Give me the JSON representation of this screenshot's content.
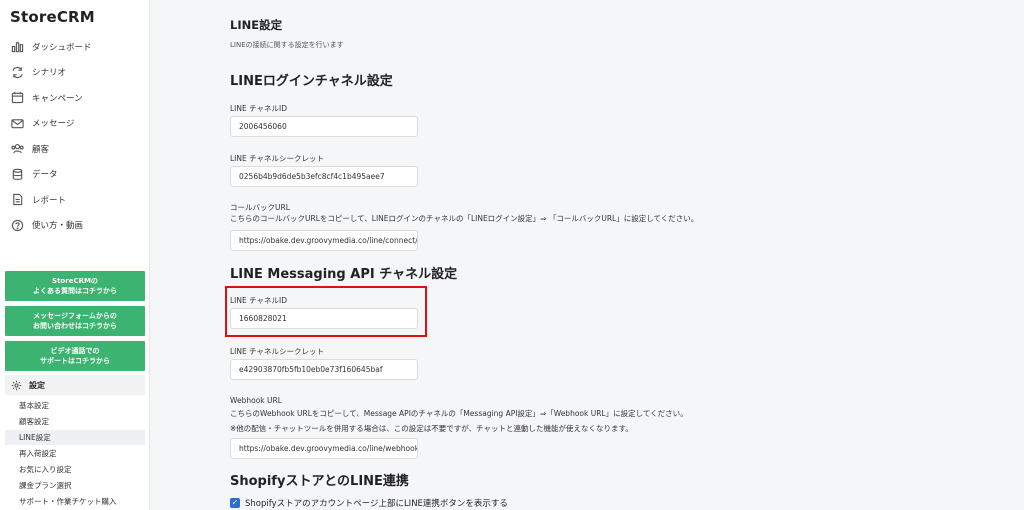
{
  "app": {
    "logo": "StoreCRM"
  },
  "nav": [
    {
      "label": "ダッシュボード",
      "icon": "bar-chart-icon"
    },
    {
      "label": "シナリオ",
      "icon": "refresh-icon"
    },
    {
      "label": "キャンペーン",
      "icon": "calendar-icon"
    },
    {
      "label": "メッセージ",
      "icon": "mail-icon"
    },
    {
      "label": "顧客",
      "icon": "users-icon"
    },
    {
      "label": "データ",
      "icon": "database-icon"
    },
    {
      "label": "レポート",
      "icon": "document-icon"
    },
    {
      "label": "使い方・動画",
      "icon": "question-icon"
    }
  ],
  "help_buttons": [
    {
      "line1": "StoreCRMの",
      "line2": "よくある質問はコチラから"
    },
    {
      "line1": "メッセージフォームからの",
      "line2": "お問い合わせはコチラから"
    },
    {
      "line1": "ビデオ通話での",
      "line2": "サポートはコチラから"
    }
  ],
  "settings": {
    "label": "設定",
    "items": [
      "基本設定",
      "顧客設定",
      "LINE設定",
      "再入荷設定",
      "お気に入り設定",
      "課金プラン選択",
      "サポート・作業チケット購入"
    ],
    "active_index": 2
  },
  "page": {
    "title": "LINE設定",
    "description": "LINEの接続に関する設定を行います",
    "login_section": {
      "heading": "LINEログインチャネル設定",
      "channel_id_label": "LINE チャネルID",
      "channel_id": "2006456060",
      "secret_label": "LINE チャネルシークレット",
      "secret": "0256b4b9d6de5b3efc8cf4c1b495aee7",
      "callback_label": "コールバックURL",
      "callback_note": "こちらのコールバックURLをコピーして、LINEログインのチャネルの「LINEログイン設定」⇒ 「コールバックURL」に設定してください。",
      "callback_url": "https://obake.dev.groovymedia.co/line/connect/"
    },
    "messaging_section": {
      "heading": "LINE Messaging API チャネル設定",
      "channel_id_label": "LINE チャネルID",
      "channel_id": "1660828021",
      "secret_label": "LINE チャネルシークレット",
      "secret": "e42903870fb5fb10eb0e73f160645baf",
      "webhook_label": "Webhook URL",
      "webhook_note1": "こちらのWebhook URLをコピーして、Message APIのチャネルの「Messaging API設定」⇒「Webhook URL」に設定してください。",
      "webhook_note2": "※他の配信・チャットツールを併用する場合は、この設定は不要ですが、チャットと連動した機能が使えなくなります。",
      "webhook_url": "https://obake.dev.groovymedia.co/line/webhook"
    },
    "shopify_section": {
      "heading": "ShopifyストアとのLINE連携",
      "checkbox_label": "Shopifyストアのアカウントページ上部にLINE連携ボタンを表示する",
      "checked": true
    }
  },
  "colors": {
    "green": "#3cb371",
    "highlight": "#e01010",
    "checkbox": "#2b6fd6"
  }
}
